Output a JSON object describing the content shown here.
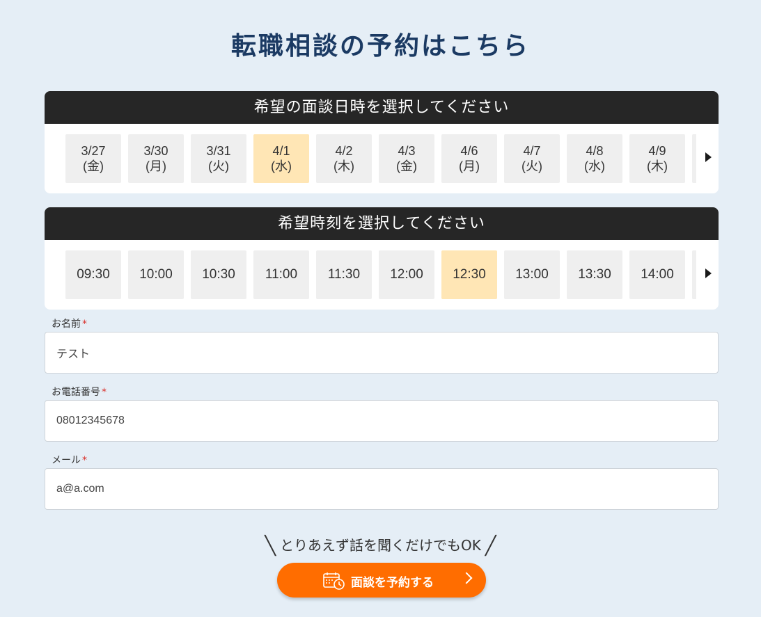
{
  "page": {
    "title": "転職相談の予約はこちら"
  },
  "date_picker": {
    "header": "希望の面談日時を選択してください",
    "selected_index": 3,
    "slots": [
      {
        "date": "3/27",
        "weekday": "(金)"
      },
      {
        "date": "3/30",
        "weekday": "(月)"
      },
      {
        "date": "3/31",
        "weekday": "(火)"
      },
      {
        "date": "4/1",
        "weekday": "(水)"
      },
      {
        "date": "4/2",
        "weekday": "(木)"
      },
      {
        "date": "4/3",
        "weekday": "(金)"
      },
      {
        "date": "4/6",
        "weekday": "(月)"
      },
      {
        "date": "4/7",
        "weekday": "(火)"
      },
      {
        "date": "4/8",
        "weekday": "(水)"
      },
      {
        "date": "4/9",
        "weekday": "(木)"
      }
    ]
  },
  "time_picker": {
    "header": "希望時刻を選択してください",
    "selected_index": 6,
    "slots": [
      "09:30",
      "10:00",
      "10:30",
      "11:00",
      "11:30",
      "12:00",
      "12:30",
      "13:00",
      "13:30",
      "14:00"
    ]
  },
  "form": {
    "name": {
      "label": "お名前",
      "required_mark": "*",
      "value": "テスト"
    },
    "phone": {
      "label": "お電話番号",
      "required_mark": "*",
      "value": "08012345678"
    },
    "email": {
      "label": "メール",
      "required_mark": "*",
      "value": "a@a.com"
    }
  },
  "cta": {
    "caption": "とりあえず話を聞くだけでもOK",
    "slash_left": "╲",
    "slash_right": "╱",
    "button_label": "面談を予約する",
    "button_icon": "calendar-clock-icon",
    "chevron_icon": "chevron-right-icon"
  },
  "colors": {
    "background": "#e5eef6",
    "title": "#1b3a63",
    "panel_header": "#262626",
    "slot_default": "#efefef",
    "slot_selected": "#ffe6b5",
    "required": "#d9302b",
    "cta": "#ff6d00"
  }
}
